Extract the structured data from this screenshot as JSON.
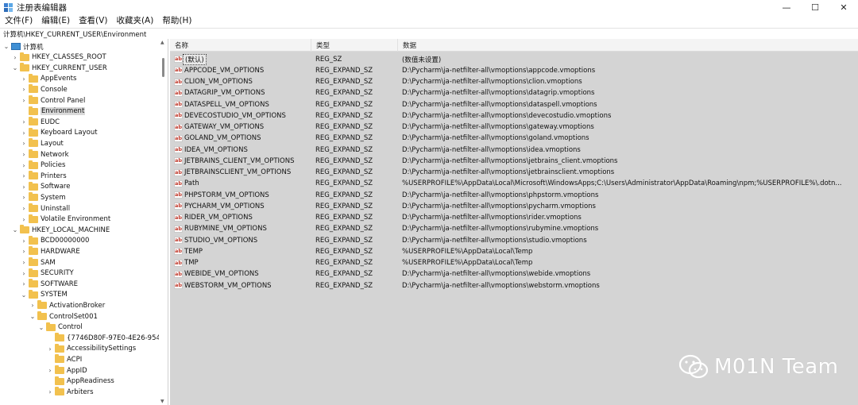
{
  "window": {
    "title": "注册表编辑器",
    "controls": [
      "—",
      "☐",
      "✕"
    ]
  },
  "menu": [
    "文件(F)",
    "编辑(E)",
    "查看(V)",
    "收藏夹(A)",
    "帮助(H)"
  ],
  "address": "计算机\\HKEY_CURRENT_USER\\Environment",
  "tree": [
    {
      "label": "计算机",
      "indent": 0,
      "expanded": true,
      "type": "computer"
    },
    {
      "label": "HKEY_CLASSES_ROOT",
      "indent": 1,
      "expanded": false
    },
    {
      "label": "HKEY_CURRENT_USER",
      "indent": 1,
      "expanded": true
    },
    {
      "label": "AppEvents",
      "indent": 2,
      "expanded": false
    },
    {
      "label": "Console",
      "indent": 2,
      "expanded": false
    },
    {
      "label": "Control Panel",
      "indent": 2,
      "expanded": false
    },
    {
      "label": "Environment",
      "indent": 2,
      "expanded": null,
      "selected": true
    },
    {
      "label": "EUDC",
      "indent": 2,
      "expanded": false
    },
    {
      "label": "Keyboard Layout",
      "indent": 2,
      "expanded": false
    },
    {
      "label": "Layout",
      "indent": 2,
      "expanded": false
    },
    {
      "label": "Network",
      "indent": 2,
      "expanded": false
    },
    {
      "label": "Policies",
      "indent": 2,
      "expanded": false
    },
    {
      "label": "Printers",
      "indent": 2,
      "expanded": false
    },
    {
      "label": "Software",
      "indent": 2,
      "expanded": false
    },
    {
      "label": "System",
      "indent": 2,
      "expanded": false
    },
    {
      "label": "Uninstall",
      "indent": 2,
      "expanded": false
    },
    {
      "label": "Volatile Environment",
      "indent": 2,
      "expanded": false
    },
    {
      "label": "HKEY_LOCAL_MACHINE",
      "indent": 1,
      "expanded": true
    },
    {
      "label": "BCD00000000",
      "indent": 2,
      "expanded": false
    },
    {
      "label": "HARDWARE",
      "indent": 2,
      "expanded": false
    },
    {
      "label": "SAM",
      "indent": 2,
      "expanded": false
    },
    {
      "label": "SECURITY",
      "indent": 2,
      "expanded": false
    },
    {
      "label": "SOFTWARE",
      "indent": 2,
      "expanded": false
    },
    {
      "label": "SYSTEM",
      "indent": 2,
      "expanded": true
    },
    {
      "label": "ActivationBroker",
      "indent": 3,
      "expanded": false
    },
    {
      "label": "ControlSet001",
      "indent": 3,
      "expanded": true
    },
    {
      "label": "Control",
      "indent": 4,
      "expanded": true
    },
    {
      "label": "{7746D80F-97E0-4E26-9543-2",
      "indent": 5,
      "expanded": null
    },
    {
      "label": "AccessibilitySettings",
      "indent": 5,
      "expanded": false
    },
    {
      "label": "ACPI",
      "indent": 5,
      "expanded": null
    },
    {
      "label": "AppID",
      "indent": 5,
      "expanded": false
    },
    {
      "label": "AppReadiness",
      "indent": 5,
      "expanded": null
    },
    {
      "label": "Arbiters",
      "indent": 5,
      "expanded": false
    }
  ],
  "columns": {
    "name": "名称",
    "type": "类型",
    "data": "数据"
  },
  "values": [
    {
      "name": "(默认)",
      "type": "REG_SZ",
      "data": "(数值未设置)",
      "default": true
    },
    {
      "name": "APPCODE_VM_OPTIONS",
      "type": "REG_EXPAND_SZ",
      "data": "D:\\Pycharm\\ja-netfilter-all\\vmoptions\\appcode.vmoptions"
    },
    {
      "name": "CLION_VM_OPTIONS",
      "type": "REG_EXPAND_SZ",
      "data": "D:\\Pycharm\\ja-netfilter-all\\vmoptions\\clion.vmoptions"
    },
    {
      "name": "DATAGRIP_VM_OPTIONS",
      "type": "REG_EXPAND_SZ",
      "data": "D:\\Pycharm\\ja-netfilter-all\\vmoptions\\datagrip.vmoptions"
    },
    {
      "name": "DATASPELL_VM_OPTIONS",
      "type": "REG_EXPAND_SZ",
      "data": "D:\\Pycharm\\ja-netfilter-all\\vmoptions\\dataspell.vmoptions"
    },
    {
      "name": "DEVECOSTUDIO_VM_OPTIONS",
      "type": "REG_EXPAND_SZ",
      "data": "D:\\Pycharm\\ja-netfilter-all\\vmoptions\\devecostudio.vmoptions"
    },
    {
      "name": "GATEWAY_VM_OPTIONS",
      "type": "REG_EXPAND_SZ",
      "data": "D:\\Pycharm\\ja-netfilter-all\\vmoptions\\gateway.vmoptions"
    },
    {
      "name": "GOLAND_VM_OPTIONS",
      "type": "REG_EXPAND_SZ",
      "data": "D:\\Pycharm\\ja-netfilter-all\\vmoptions\\goland.vmoptions"
    },
    {
      "name": "IDEA_VM_OPTIONS",
      "type": "REG_EXPAND_SZ",
      "data": "D:\\Pycharm\\ja-netfilter-all\\vmoptions\\idea.vmoptions"
    },
    {
      "name": "JETBRAINS_CLIENT_VM_OPTIONS",
      "type": "REG_EXPAND_SZ",
      "data": "D:\\Pycharm\\ja-netfilter-all\\vmoptions\\jetbrains_client.vmoptions"
    },
    {
      "name": "JETBRAINSCLIENT_VM_OPTIONS",
      "type": "REG_EXPAND_SZ",
      "data": "D:\\Pycharm\\ja-netfilter-all\\vmoptions\\jetbrainsclient.vmoptions"
    },
    {
      "name": "Path",
      "type": "REG_EXPAND_SZ",
      "data": "%USERPROFILE%\\AppData\\Local\\Microsoft\\WindowsApps;C:\\Users\\Administrator\\AppData\\Roaming\\npm;%USERPROFILE%\\.dotn..."
    },
    {
      "name": "PHPSTORM_VM_OPTIONS",
      "type": "REG_EXPAND_SZ",
      "data": "D:\\Pycharm\\ja-netfilter-all\\vmoptions\\phpstorm.vmoptions"
    },
    {
      "name": "PYCHARM_VM_OPTIONS",
      "type": "REG_EXPAND_SZ",
      "data": "D:\\Pycharm\\ja-netfilter-all\\vmoptions\\pycharm.vmoptions"
    },
    {
      "name": "RIDER_VM_OPTIONS",
      "type": "REG_EXPAND_SZ",
      "data": "D:\\Pycharm\\ja-netfilter-all\\vmoptions\\rider.vmoptions"
    },
    {
      "name": "RUBYMINE_VM_OPTIONS",
      "type": "REG_EXPAND_SZ",
      "data": "D:\\Pycharm\\ja-netfilter-all\\vmoptions\\rubymine.vmoptions"
    },
    {
      "name": "STUDIO_VM_OPTIONS",
      "type": "REG_EXPAND_SZ",
      "data": "D:\\Pycharm\\ja-netfilter-all\\vmoptions\\studio.vmoptions"
    },
    {
      "name": "TEMP",
      "type": "REG_EXPAND_SZ",
      "data": "%USERPROFILE%\\AppData\\Local\\Temp"
    },
    {
      "name": "TMP",
      "type": "REG_EXPAND_SZ",
      "data": "%USERPROFILE%\\AppData\\Local\\Temp"
    },
    {
      "name": "WEBIDE_VM_OPTIONS",
      "type": "REG_EXPAND_SZ",
      "data": "D:\\Pycharm\\ja-netfilter-all\\vmoptions\\webide.vmoptions"
    },
    {
      "name": "WEBSTORM_VM_OPTIONS",
      "type": "REG_EXPAND_SZ",
      "data": "D:\\Pycharm\\ja-netfilter-all\\vmoptions\\webstorm.vmoptions"
    }
  ],
  "watermark": "M01N Team",
  "colors": {
    "pane_bg": "#d4d4d4",
    "folder": "#f2c14e",
    "icon_red": "#c0392b"
  }
}
